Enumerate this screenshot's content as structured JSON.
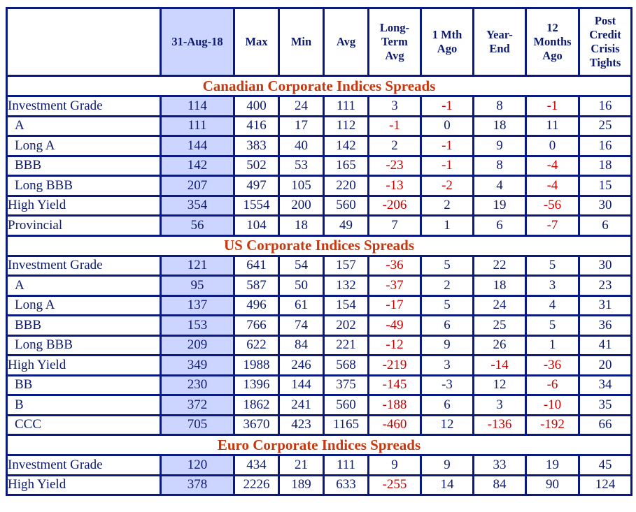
{
  "columns": [
    "",
    "31-Aug-18",
    "Max",
    "Min",
    "Avg",
    "Long-\nTerm\nAvg",
    "1 Mth\nAgo",
    "Year-\nEnd",
    "12\nMonths\nAgo",
    "Post\nCredit\nCrisis\nTights"
  ],
  "colors": {
    "header_text": "#0d1a6e",
    "border": "#0a1a80",
    "date_column_bg": "#ccd5ff",
    "section_title": "#c8380e",
    "negative_highlight": "#cc0000"
  },
  "sections": [
    {
      "title": "Canadian Corporate Indices Spreads",
      "rows": [
        {
          "label": "Investment Grade",
          "sub": false,
          "values": [
            "114",
            "400",
            "24",
            "111",
            "3",
            "-1",
            "8",
            "-1",
            "16"
          ],
          "red": [
            false,
            false,
            false,
            false,
            false,
            true,
            false,
            true,
            false
          ]
        },
        {
          "label": "A",
          "sub": true,
          "values": [
            "111",
            "416",
            "17",
            "112",
            "-1",
            "0",
            "18",
            "11",
            "25"
          ],
          "red": [
            false,
            false,
            false,
            false,
            true,
            false,
            false,
            false,
            false
          ]
        },
        {
          "label": "Long A",
          "sub": true,
          "values": [
            "144",
            "383",
            "40",
            "142",
            "2",
            "-1",
            "9",
            "0",
            "16"
          ],
          "red": [
            false,
            false,
            false,
            false,
            false,
            true,
            false,
            false,
            false
          ]
        },
        {
          "label": "BBB",
          "sub": true,
          "values": [
            "142",
            "502",
            "53",
            "165",
            "-23",
            "-1",
            "8",
            "-4",
            "18"
          ],
          "red": [
            false,
            false,
            false,
            false,
            true,
            true,
            false,
            true,
            false
          ]
        },
        {
          "label": "Long BBB",
          "sub": true,
          "values": [
            "207",
            "497",
            "105",
            "220",
            "-13",
            "-2",
            "4",
            "-4",
            "15"
          ],
          "red": [
            false,
            false,
            false,
            false,
            true,
            true,
            false,
            true,
            false
          ]
        },
        {
          "label": "High Yield",
          "sub": false,
          "values": [
            "354",
            "1554",
            "200",
            "560",
            "-206",
            "2",
            "19",
            "-56",
            "30"
          ],
          "red": [
            false,
            false,
            false,
            false,
            true,
            false,
            false,
            true,
            false
          ]
        },
        {
          "label": "Provincial",
          "sub": false,
          "values": [
            "56",
            "104",
            "18",
            "49",
            "7",
            "1",
            "6",
            "-7",
            "6"
          ],
          "red": [
            false,
            false,
            false,
            false,
            false,
            false,
            false,
            true,
            false
          ]
        }
      ]
    },
    {
      "title": "US Corporate Indices Spreads",
      "rows": [
        {
          "label": "Investment Grade",
          "sub": false,
          "values": [
            "121",
            "641",
            "54",
            "157",
            "-36",
            "5",
            "22",
            "5",
            "30"
          ],
          "red": [
            false,
            false,
            false,
            false,
            true,
            false,
            false,
            false,
            false
          ]
        },
        {
          "label": "A",
          "sub": true,
          "values": [
            "95",
            "587",
            "50",
            "132",
            "-37",
            "2",
            "18",
            "3",
            "23"
          ],
          "red": [
            false,
            false,
            false,
            false,
            true,
            false,
            false,
            false,
            false
          ]
        },
        {
          "label": "Long A",
          "sub": true,
          "values": [
            "137",
            "496",
            "61",
            "154",
            "-17",
            "5",
            "24",
            "4",
            "31"
          ],
          "red": [
            false,
            false,
            false,
            false,
            true,
            false,
            false,
            false,
            false
          ]
        },
        {
          "label": "BBB",
          "sub": true,
          "values": [
            "153",
            "766",
            "74",
            "202",
            "-49",
            "6",
            "25",
            "5",
            "36"
          ],
          "red": [
            false,
            false,
            false,
            false,
            true,
            false,
            false,
            false,
            false
          ]
        },
        {
          "label": "Long BBB",
          "sub": true,
          "values": [
            "209",
            "622",
            "84",
            "221",
            "-12",
            "9",
            "26",
            "1",
            "41"
          ],
          "red": [
            false,
            false,
            false,
            false,
            true,
            false,
            false,
            false,
            false
          ]
        },
        {
          "label": "High Yield",
          "sub": false,
          "values": [
            "349",
            "1988",
            "246",
            "568",
            "-219",
            "3",
            "-14",
            "-36",
            "20"
          ],
          "red": [
            false,
            false,
            false,
            false,
            true,
            false,
            true,
            true,
            false
          ]
        },
        {
          "label": "BB",
          "sub": true,
          "values": [
            "230",
            "1396",
            "144",
            "375",
            "-145",
            "-3",
            "12",
            "-6",
            "34"
          ],
          "red": [
            false,
            false,
            false,
            false,
            true,
            false,
            false,
            true,
            false
          ]
        },
        {
          "label": "B",
          "sub": true,
          "values": [
            "372",
            "1862",
            "241",
            "560",
            "-188",
            "6",
            "3",
            "-10",
            "35"
          ],
          "red": [
            false,
            false,
            false,
            false,
            true,
            false,
            false,
            true,
            false
          ]
        },
        {
          "label": "CCC",
          "sub": true,
          "values": [
            "705",
            "3670",
            "423",
            "1165",
            "-460",
            "12",
            "-136",
            "-192",
            "66"
          ],
          "red": [
            false,
            false,
            false,
            false,
            true,
            false,
            true,
            true,
            false
          ]
        }
      ]
    },
    {
      "title": "Euro Corporate Indices Spreads",
      "rows": [
        {
          "label": "Investment Grade",
          "sub": false,
          "values": [
            "120",
            "434",
            "21",
            "111",
            "9",
            "9",
            "33",
            "19",
            "45"
          ],
          "red": [
            false,
            false,
            false,
            false,
            false,
            false,
            false,
            false,
            false
          ]
        },
        {
          "label": "High Yield",
          "sub": false,
          "values": [
            "378",
            "2226",
            "189",
            "633",
            "-255",
            "14",
            "84",
            "90",
            "124"
          ],
          "red": [
            false,
            false,
            false,
            false,
            true,
            false,
            false,
            false,
            false
          ]
        }
      ]
    }
  ]
}
